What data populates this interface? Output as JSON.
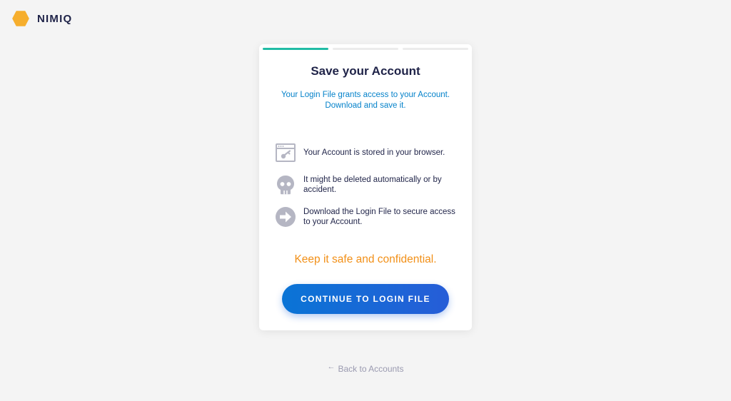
{
  "brand": {
    "name": "NIMIQ",
    "logo_color": "#f6ae2d",
    "text_color": "#1f2348"
  },
  "card": {
    "progress": {
      "total_steps": 3,
      "current_step": 1,
      "active_color": "#21bca5"
    },
    "title": "Save your Account",
    "intro_line1": "Your Login File grants access to your Account.",
    "intro_line2": "Download and save it.",
    "items": [
      {
        "icon": "browser-key-icon",
        "text": "Your Account is stored in your browser."
      },
      {
        "icon": "skull-icon",
        "text": "It might be deleted automatically or by accident."
      },
      {
        "icon": "arrow-circle-icon",
        "text": "Download the Login File to secure access to your Account."
      }
    ],
    "keep_safe": "Keep it safe and confidential.",
    "button_label": "CONTINUE TO LOGIN FILE"
  },
  "back_link": {
    "arrow": "←",
    "label": "Back to Accounts"
  },
  "colors": {
    "background": "#f4f4f4",
    "accent_blue": "#0582ca",
    "warning_orange": "#f29018",
    "icon_gray": "#b5b6c3"
  }
}
